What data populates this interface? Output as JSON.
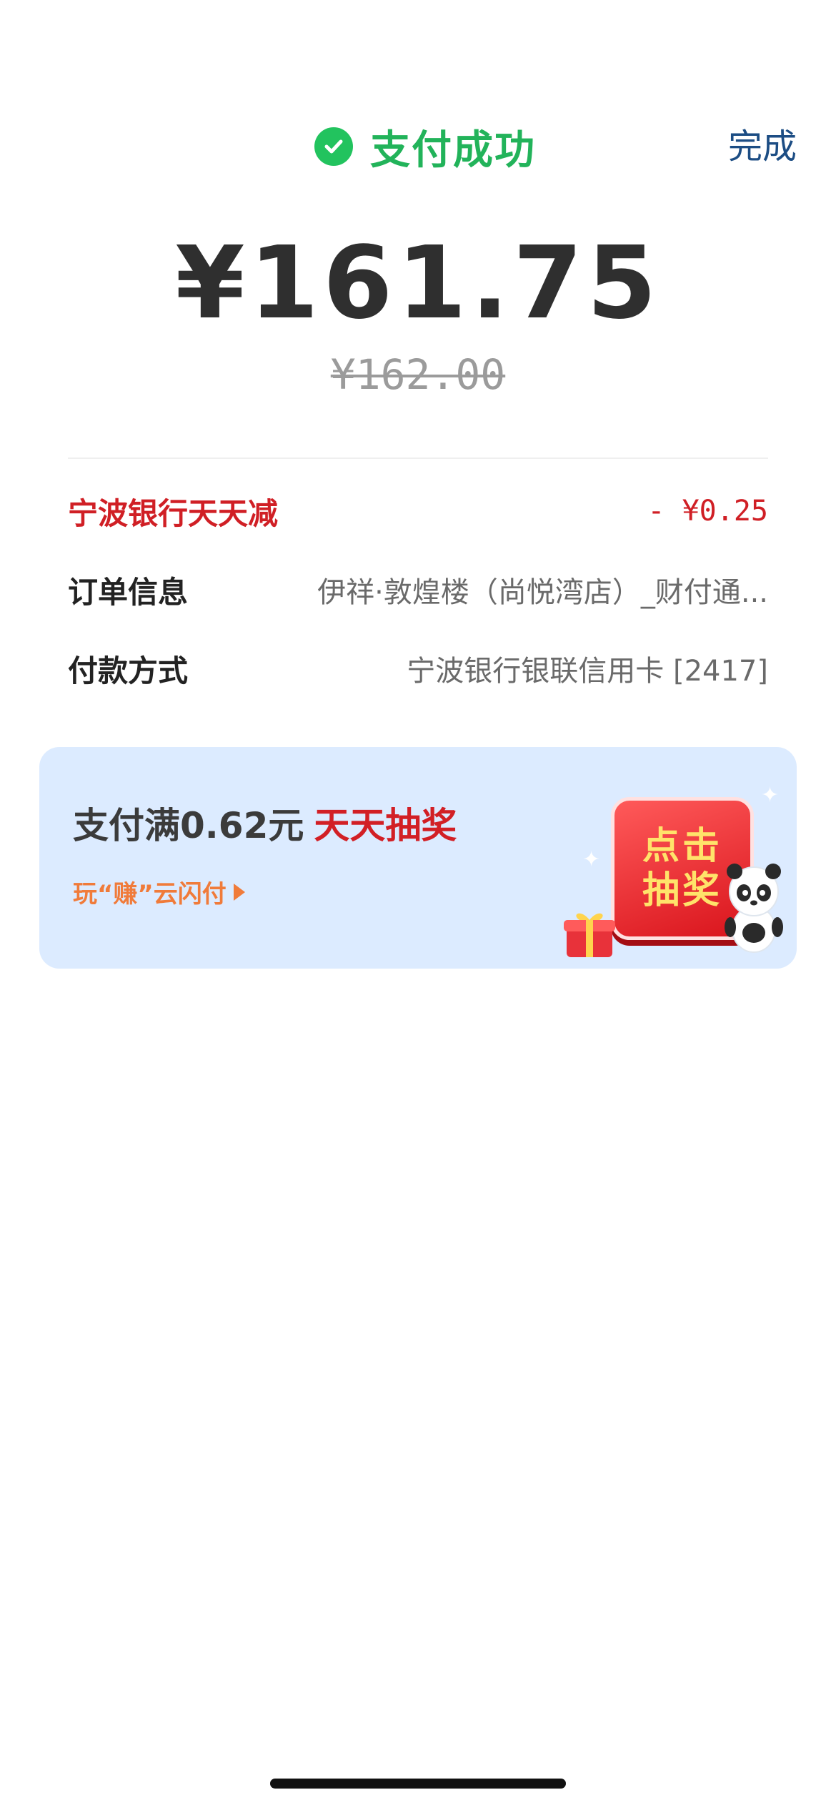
{
  "header": {
    "status": "支付成功",
    "done_label": "完成"
  },
  "payment": {
    "amount": "¥161.75",
    "original_amount": "¥162.00"
  },
  "details": {
    "discount": {
      "label": "宁波银行天天减",
      "value": "- ¥0.25"
    },
    "order": {
      "label": "订单信息",
      "value": "伊祥·敦煌楼（尚悦湾店）_财付通..."
    },
    "payment_method": {
      "label": "付款方式",
      "value": "宁波银行银联信用卡 [2417]"
    }
  },
  "promo": {
    "title_prefix": "支付满0.62元",
    "title_highlight": "天天抽奖",
    "subtitle": "玩“赚”云闪付",
    "button_line1": "点击",
    "button_line2": "抽奖"
  },
  "colors": {
    "success_green": "#22b35a",
    "discount_red": "#d01f25",
    "link_blue": "#1c4d84",
    "promo_bg": "#dcebff",
    "promo_orange": "#f07b3a"
  },
  "icons": {
    "success": "check-circle-icon",
    "promo_arrow": "play-arrow-icon",
    "gift": "gift-icon",
    "panda": "panda-mascot"
  }
}
